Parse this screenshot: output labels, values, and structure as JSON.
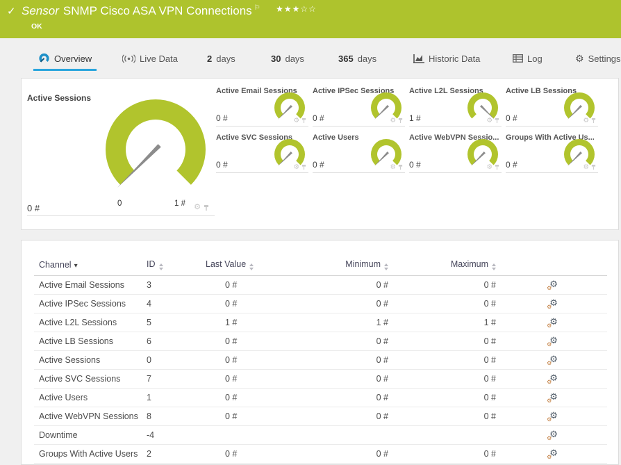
{
  "header": {
    "type_label": "Sensor",
    "title": "SNMP Cisco ASA VPN Connections",
    "status": "OK",
    "stars_filled": "★★★",
    "stars_empty": "☆☆"
  },
  "tabs": [
    {
      "id": "overview",
      "label": "Overview",
      "icon": "gauge-icon",
      "active": true
    },
    {
      "id": "live-data",
      "label": "Live Data",
      "icon": "live-icon",
      "active": false
    },
    {
      "id": "2-days",
      "num": "2",
      "label": "days",
      "active": false
    },
    {
      "id": "30-days",
      "num": "30",
      "label": "days",
      "active": false
    },
    {
      "id": "365-days",
      "num": "365",
      "label": "days",
      "active": false
    },
    {
      "id": "historic-data",
      "label": "Historic Data",
      "icon": "chart-icon",
      "active": false
    },
    {
      "id": "log",
      "label": "Log",
      "icon": "log-icon",
      "active": false
    },
    {
      "id": "settings",
      "label": "Settings",
      "icon": "gear-icon",
      "active": false
    }
  ],
  "main_gauge": {
    "title": "Active Sessions",
    "value": "0 #",
    "scale_min": "0",
    "scale_max": "1 #",
    "fraction": 0
  },
  "small_gauges": [
    {
      "title": "Active Email Sessions",
      "value": "0 #",
      "fraction": 0
    },
    {
      "title": "Active IPSec Sessions",
      "value": "0 #",
      "fraction": 0
    },
    {
      "title": "Active L2L Sessions",
      "value": "1 #",
      "fraction": 1
    },
    {
      "title": "Active LB Sessions",
      "value": "0 #",
      "fraction": 0
    },
    {
      "title": "Active SVC Sessions",
      "value": "0 #",
      "fraction": 0
    },
    {
      "title": "Active Users",
      "value": "0 #",
      "fraction": 0
    },
    {
      "title": "Active WebVPN Sessio...",
      "value": "0 #",
      "fraction": 0
    },
    {
      "title": "Groups With Active Us...",
      "value": "0 #",
      "fraction": 0
    }
  ],
  "channel_table": {
    "columns": [
      {
        "key": "channel",
        "label": "Channel",
        "sort": "desc"
      },
      {
        "key": "id",
        "label": "ID",
        "sort": "none"
      },
      {
        "key": "last",
        "label": "Last Value",
        "sort": "none"
      },
      {
        "key": "min",
        "label": "Minimum",
        "sort": "none"
      },
      {
        "key": "max",
        "label": "Maximum",
        "sort": "none"
      }
    ],
    "rows": [
      {
        "channel": "Active Email Sessions",
        "id": "3",
        "last": "0 #",
        "min": "0 #",
        "max": "0 #"
      },
      {
        "channel": "Active IPSec Sessions",
        "id": "4",
        "last": "0 #",
        "min": "0 #",
        "max": "0 #"
      },
      {
        "channel": "Active L2L Sessions",
        "id": "5",
        "last": "1 #",
        "min": "1 #",
        "max": "1 #"
      },
      {
        "channel": "Active LB Sessions",
        "id": "6",
        "last": "0 #",
        "min": "0 #",
        "max": "0 #"
      },
      {
        "channel": "Active Sessions",
        "id": "0",
        "last": "0 #",
        "min": "0 #",
        "max": "0 #"
      },
      {
        "channel": "Active SVC Sessions",
        "id": "7",
        "last": "0 #",
        "min": "0 #",
        "max": "0 #"
      },
      {
        "channel": "Active Users",
        "id": "1",
        "last": "0 #",
        "min": "0 #",
        "max": "0 #"
      },
      {
        "channel": "Active WebVPN Sessions",
        "id": "8",
        "last": "0 #",
        "min": "0 #",
        "max": "0 #"
      },
      {
        "channel": "Downtime",
        "id": "-4",
        "last": "",
        "min": "",
        "max": ""
      },
      {
        "channel": "Groups With Active Users",
        "id": "2",
        "last": "0 #",
        "min": "0 #",
        "max": "0 #"
      }
    ]
  },
  "colors": {
    "header_bg": "#aec32d",
    "gauge_green": "#b1c42d",
    "needle_gray": "#8c8c8c",
    "accent_blue": "#2aa5dd"
  }
}
